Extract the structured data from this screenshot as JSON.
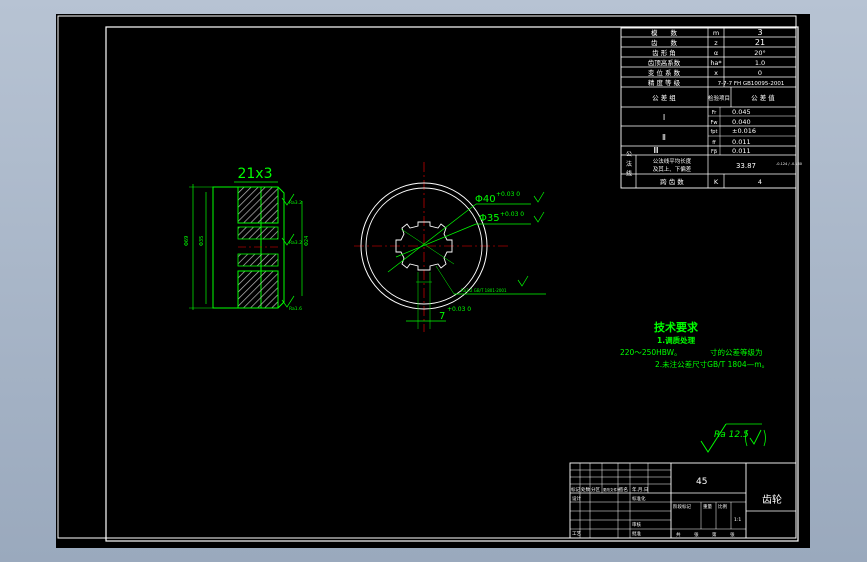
{
  "parameter_table": {
    "rows": [
      {
        "label": "模　　数",
        "symbol": "m",
        "value": "3"
      },
      {
        "label": "齿　　数",
        "symbol": "z",
        "value": "21"
      },
      {
        "label": "齿 形 角",
        "symbol": "α",
        "value": "20°"
      },
      {
        "label": "齿顶高系数",
        "symbol": "ha*",
        "value": "1.0"
      },
      {
        "label": "变 位 系 数",
        "symbol": "x",
        "value": "0"
      },
      {
        "label": "精 度 等 级",
        "symbol": "",
        "value": "7-7-7 FH GB10095-2001"
      }
    ],
    "group_header": {
      "label": "公 差 组",
      "col2": "检验项目",
      "col3": "公 差 值"
    },
    "groups": [
      {
        "name": "Ⅰ",
        "items": [
          {
            "symbol": "Fr",
            "value": "0.045"
          },
          {
            "symbol": "Fw",
            "value": "0.040"
          }
        ]
      },
      {
        "name": "Ⅱ",
        "items": [
          {
            "symbol": "fpt",
            "value": "±0.016"
          },
          {
            "symbol": "ff",
            "value": "0.011"
          }
        ]
      },
      {
        "name": "Ⅲ",
        "items": [
          {
            "symbol": "Fβ",
            "value": "0.011"
          }
        ]
      }
    ],
    "span_row": {
      "label": "公 法 线",
      "desc_line1": "公法线平均长度",
      "desc_line2": "及其上、下偏差",
      "value": "33.87",
      "tolerance": "-0.124 / -0.160"
    },
    "last_row": {
      "label": "跨 齿 数",
      "symbol": "K",
      "value": "4"
    }
  },
  "left_view": {
    "title": "21x3",
    "dim_outer": "Φ69",
    "dim_bore": "Φ35",
    "dim_width": "Φ24",
    "surface_marks": [
      "Ra3.2",
      "Ra3.2",
      "Ra1.6"
    ]
  },
  "front_view": {
    "dim_d1": "Φ40",
    "dim_d1_tol": "+0.03 0",
    "dim_d2": "Φ35",
    "dim_d2_tol": "+0.03 0",
    "dim_key": "7",
    "dim_key_tol": "+0.03 0",
    "key_note": "Ra3.2 GB/T 1801-2001"
  },
  "tech_requirements": {
    "title": "技术要求",
    "line1": "1.调质处理",
    "line2a": "220～250HBW。",
    "line2b": "寸的公差等级为",
    "line3": "2.未注公差尺寸GB/T 1804—m。"
  },
  "surface_finish": {
    "label": "Ra 12.5"
  },
  "title_block": {
    "material": "45",
    "part_name": "齿轮",
    "h_labels": [
      "标记",
      "处数",
      "分区",
      "更改文件号",
      "签名",
      "年.月.日"
    ],
    "row_labels": [
      "设计",
      "标准化",
      "审核",
      "工艺",
      "批准"
    ],
    "stage_labels": [
      "阶段标记",
      "重量",
      "比例"
    ],
    "scale": "1:1",
    "sheet_labels": [
      "共",
      "张",
      "第",
      "张"
    ]
  },
  "colors": {
    "background": "#000000",
    "frame": "#ffffff",
    "geometry": "#00ff00",
    "hatch": "#c8c8c8",
    "center": "#ff0000",
    "text": "#ffffff"
  }
}
